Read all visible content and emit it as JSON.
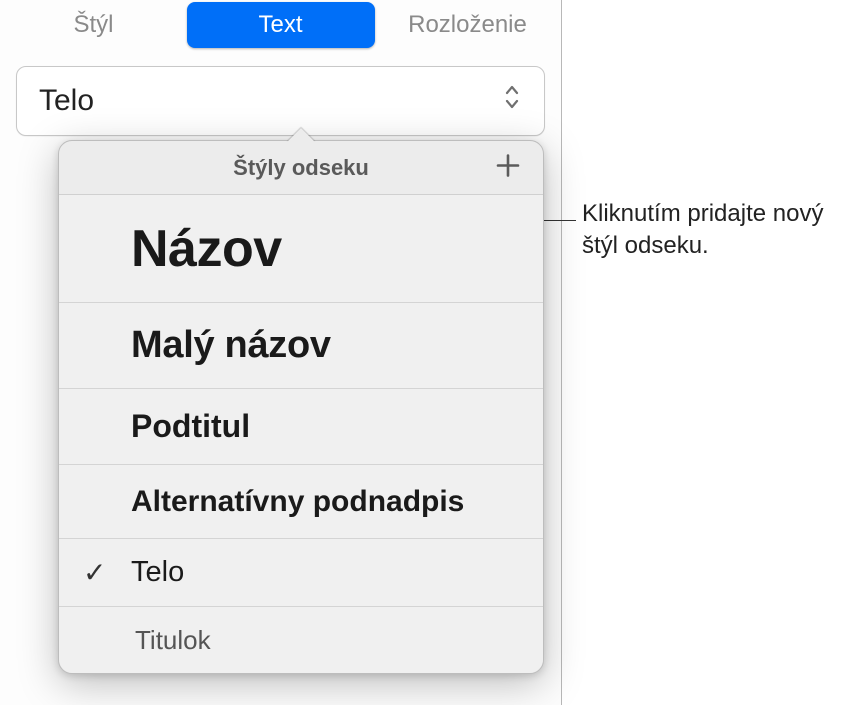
{
  "tabs": {
    "style": "Štýl",
    "text": "Text",
    "layout": "Rozloženie"
  },
  "selector": {
    "current": "Telo"
  },
  "popover": {
    "title": "Štýly odseku",
    "items": [
      {
        "label": "Názov"
      },
      {
        "label": "Malý názov"
      },
      {
        "label": "Podtitul"
      },
      {
        "label": "Alternatívny podnadpis"
      },
      {
        "label": "Telo",
        "selected": true
      },
      {
        "label": "Titulok"
      }
    ]
  },
  "callout": {
    "text": "Kliknutím pridajte nový štýl odseku."
  }
}
